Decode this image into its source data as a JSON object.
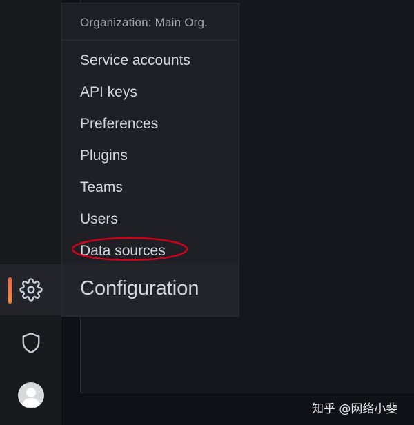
{
  "menu": {
    "header": "Organization: Main Org.",
    "items": [
      {
        "label": "Service accounts"
      },
      {
        "label": "API keys"
      },
      {
        "label": "Preferences"
      },
      {
        "label": "Plugins"
      },
      {
        "label": "Teams"
      },
      {
        "label": "Users"
      },
      {
        "label": "Data sources"
      }
    ],
    "title": "Configuration"
  },
  "sidenav": {
    "items": [
      {
        "icon": "gear-icon",
        "active": true
      },
      {
        "icon": "shield-icon",
        "active": false
      },
      {
        "icon": "user-avatar",
        "active": false
      }
    ],
    "active_indicator_color": "#f55f3e"
  },
  "annotation": {
    "color": "#d0021b",
    "target": "Data sources"
  },
  "watermark": "知乎 @网络小斐",
  "colors": {
    "background": "#111217",
    "menu_bg": "#1f2025",
    "text": "#d5d7dc",
    "muted_text": "#a3a5ac"
  }
}
